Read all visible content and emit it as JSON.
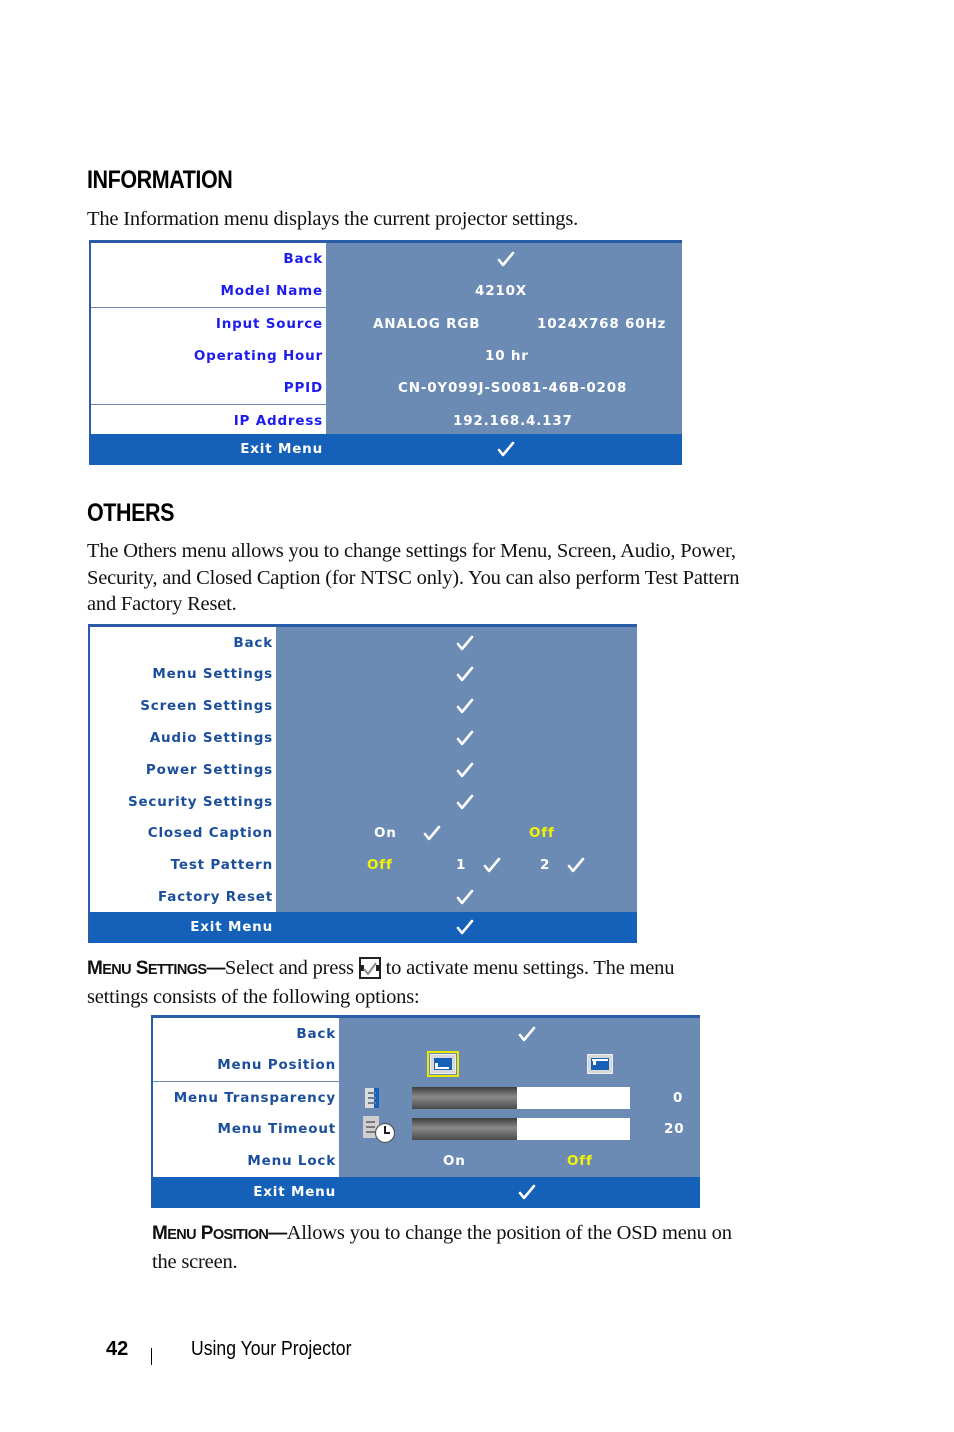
{
  "sections": {
    "information": {
      "heading": "INFORMATION",
      "description": "The Information menu displays the current projector settings.",
      "menu": {
        "rows": [
          {
            "label": "Back",
            "value": "check"
          },
          {
            "label": "Model Name",
            "value": "4210X"
          },
          {
            "label": "Input Source",
            "value": "ANALOG RGB",
            "value2": "1024X768 60Hz"
          },
          {
            "label": "Operating Hour",
            "value": "10 hr"
          },
          {
            "label": "PPID",
            "value": "CN-0Y099J-S0081-46B-0208"
          },
          {
            "label": "IP Address",
            "value": "192.168.4.137"
          }
        ],
        "exit": {
          "label": "Exit Menu"
        }
      }
    },
    "others": {
      "heading": "OTHERS",
      "description_lines": [
        "The Others menu allows you to change settings for Menu, Screen, Audio, Power,",
        "Security, and Closed Caption (for NTSC only). You can also perform Test Pattern",
        "and Factory Reset."
      ],
      "menu": {
        "rows": [
          {
            "label": "Back"
          },
          {
            "label": "Menu Settings"
          },
          {
            "label": "Screen Settings"
          },
          {
            "label": "Audio Settings"
          },
          {
            "label": "Power Settings"
          },
          {
            "label": "Security Settings"
          },
          {
            "label": "Closed Caption",
            "options": [
              "On",
              "Off"
            ],
            "selected": "Off"
          },
          {
            "label": "Test Pattern",
            "options": [
              "Off",
              "1",
              "2"
            ],
            "selected": "Off"
          },
          {
            "label": "Factory Reset"
          }
        ],
        "exit": {
          "label": "Exit Menu"
        }
      }
    },
    "menu_settings": {
      "runin_title_first": "M",
      "runin_title_first_sc": "ENU",
      "runin_title_second": "S",
      "runin_title_second_sc": "ETTINGS",
      "runin_dash": "—",
      "text_before_icon": "Select and press",
      "inline_icon": "enter-check-icon",
      "text_after_icon": "to activate menu settings. The menu",
      "text_line2": "settings consists of the following options:",
      "menu": {
        "rows": [
          {
            "label": "Back"
          },
          {
            "label": "Menu Position",
            "options": [
              "bottom-left",
              "top-left"
            ],
            "selected": "bottom-left"
          },
          {
            "label": "Menu Transparency",
            "value": "0",
            "slider_fraction": 0.48
          },
          {
            "label": "Menu Timeout",
            "value": "20",
            "slider_fraction": 0.48
          },
          {
            "label": "Menu Lock",
            "options": [
              "On",
              "Off"
            ],
            "selected": "Off"
          }
        ],
        "exit": {
          "label": "Exit Menu"
        }
      }
    },
    "menu_position": {
      "runin_title_first": "M",
      "runin_title_first_sc": "ENU",
      "runin_title_second": "P",
      "runin_title_second_sc": "OSITION",
      "runin_dash": "—",
      "text_line1": "Allows you to change the position of the OSD menu on",
      "text_line2": "the screen."
    }
  },
  "footer": {
    "page_number": "42",
    "separator": "|",
    "chapter_title": "Using Your Projector"
  },
  "colors": {
    "osd_value_bg": "#6b8bb5",
    "osd_exit_bg": "#1560b8",
    "info_label": "#1c1cf0",
    "navy_label": "#1b4f9c",
    "selected_option": "#f5f500"
  }
}
